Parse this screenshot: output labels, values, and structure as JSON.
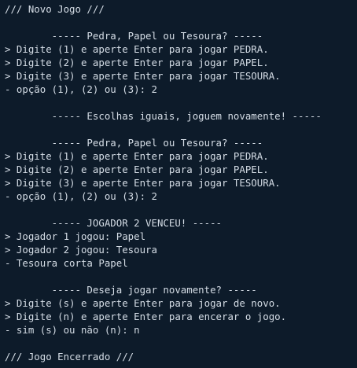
{
  "terminal": {
    "lines": [
      "/// Novo Jogo ///",
      "",
      "        ----- Pedra, Papel ou Tesoura? -----",
      "> Digite (1) e aperte Enter para jogar PEDRA.",
      "> Digite (2) e aperte Enter para jogar PAPEL.",
      "> Digite (3) e aperte Enter para jogar TESOURA.",
      "- opção (1), (2) ou (3): 2",
      "",
      "        ----- Escolhas iguais, joguem novamente! -----",
      "",
      "        ----- Pedra, Papel ou Tesoura? -----",
      "> Digite (1) e aperte Enter para jogar PEDRA.",
      "> Digite (2) e aperte Enter para jogar PAPEL.",
      "> Digite (3) e aperte Enter para jogar TESOURA.",
      "- opção (1), (2) ou (3): 2",
      "",
      "        ----- JOGADOR 2 VENCEU! -----",
      "> Jogador 1 jogou: Papel",
      "> Jogador 2 jogou: Tesoura",
      "- Tesoura corta Papel",
      "",
      "        ----- Deseja jogar novamente? -----",
      "> Digite (s) e aperte Enter para jogar de novo.",
      "> Digite (n) e aperte Enter para encerar o jogo.",
      "- sim (s) ou não (n): n",
      "",
      "/// Jogo Encerrado ///"
    ]
  },
  "colors": {
    "background": "#0d1b2a",
    "text": "#d5dde6"
  }
}
